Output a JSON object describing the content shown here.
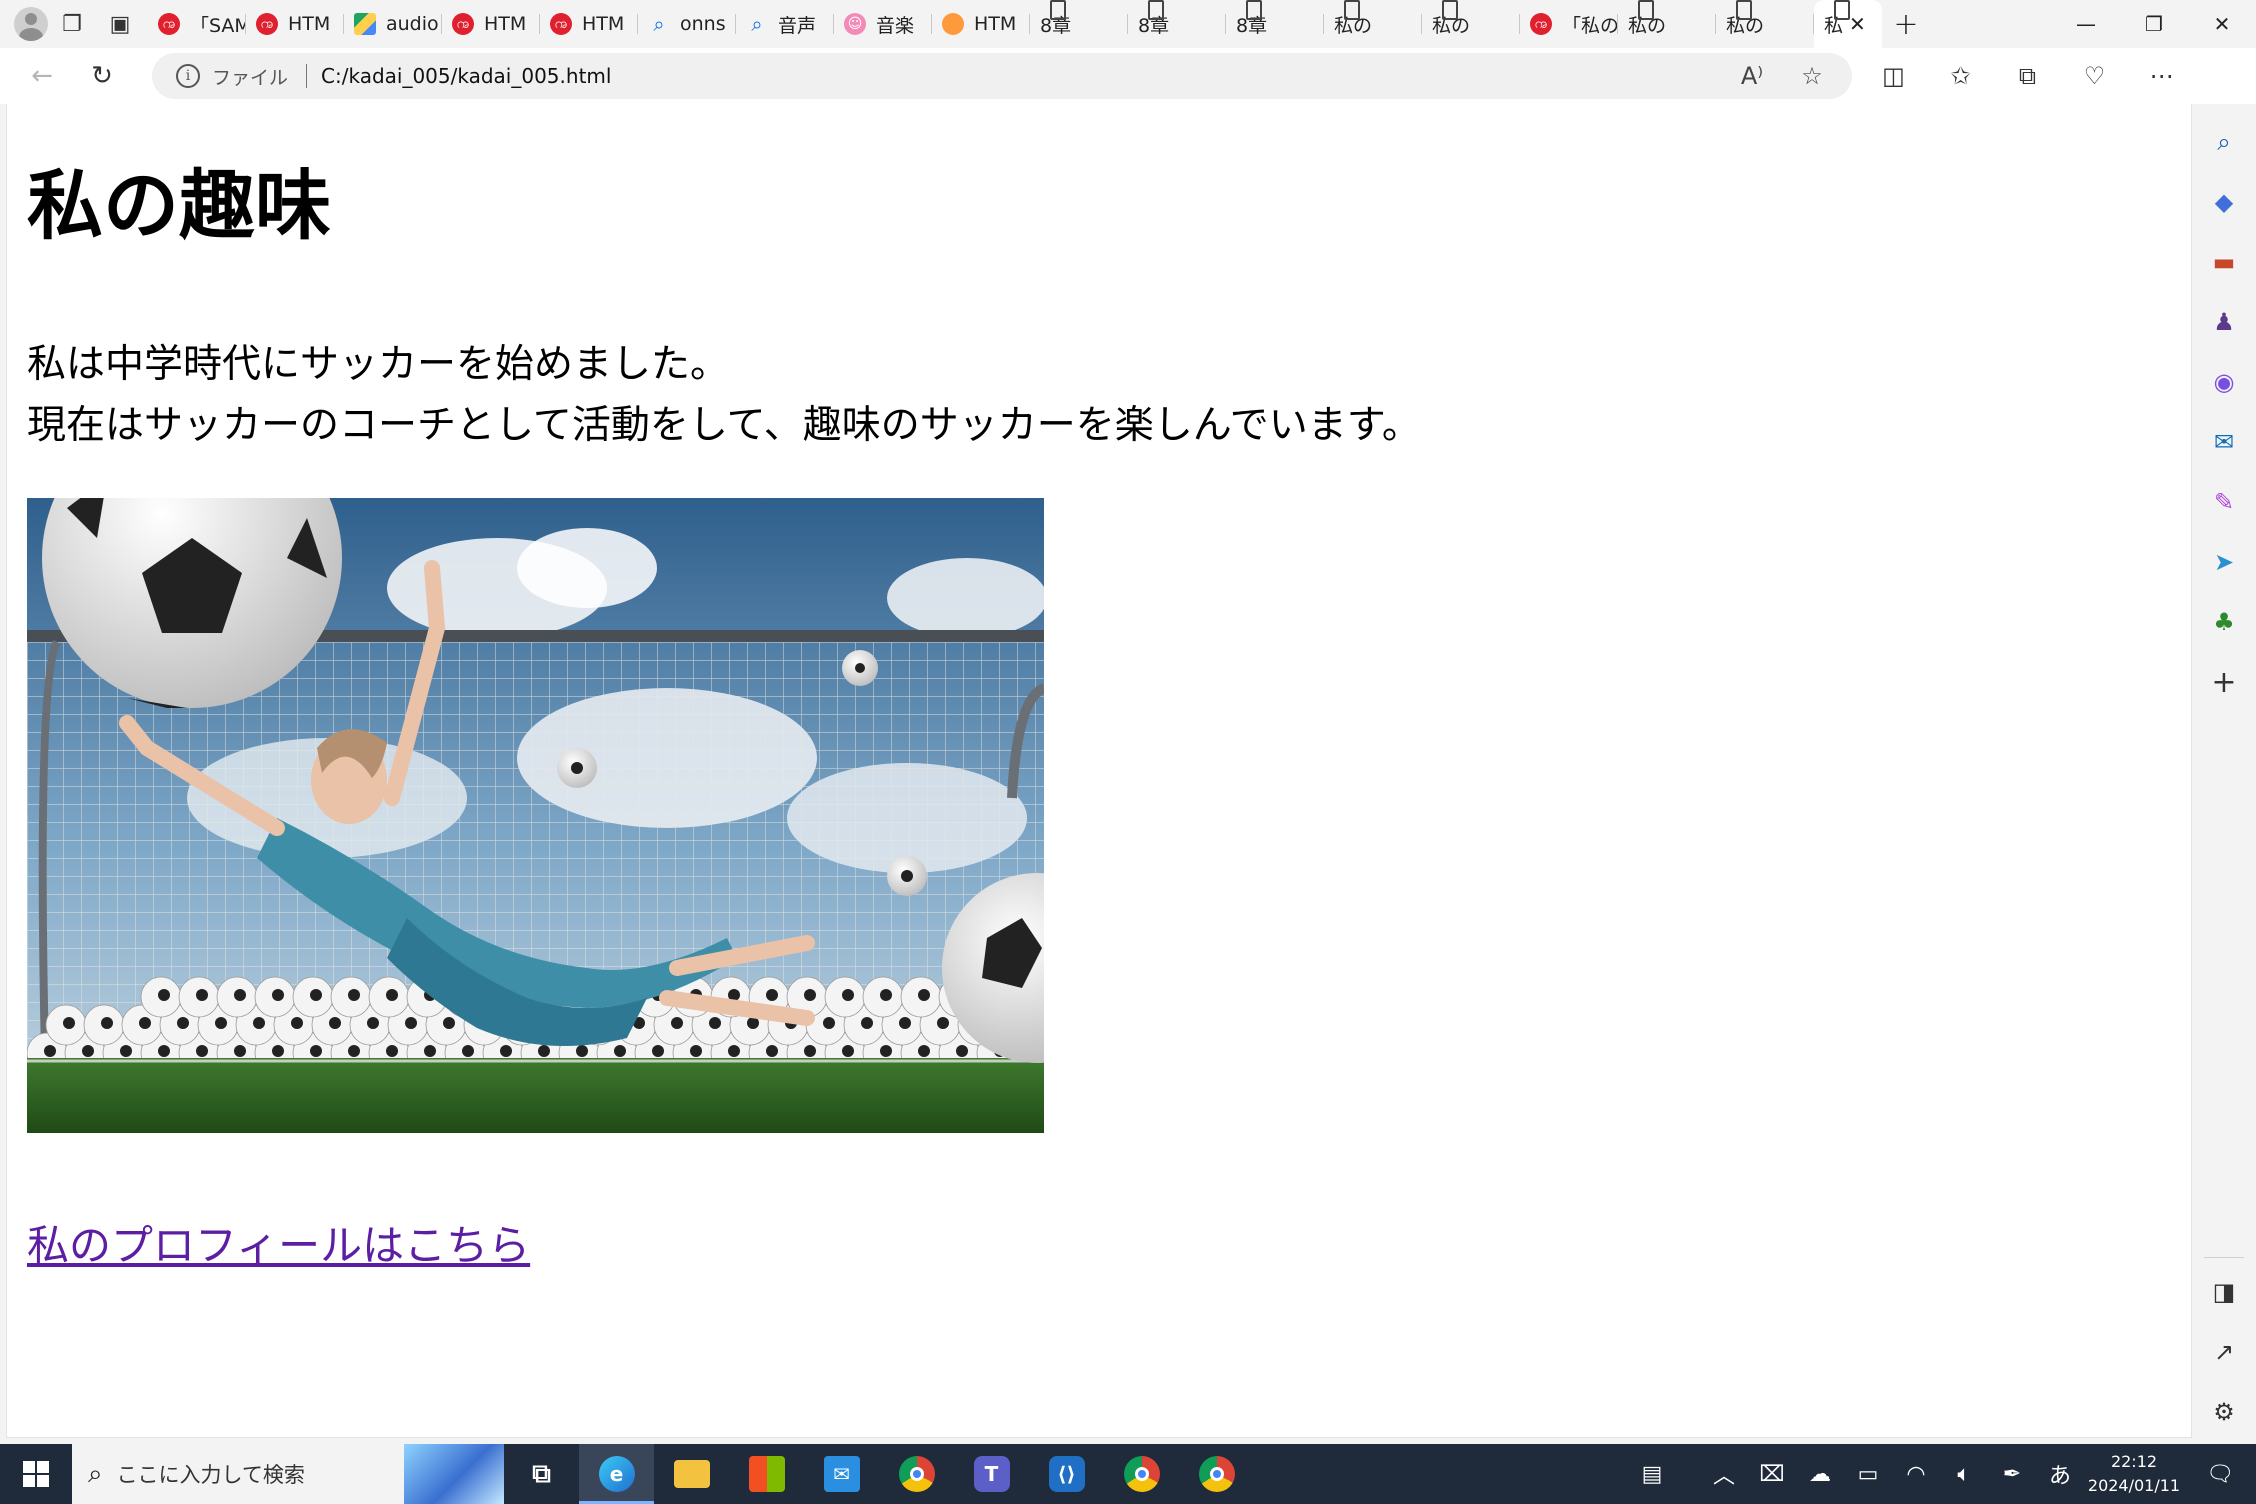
{
  "browser": {
    "tabs": [
      {
        "label": "「SAM",
        "favicon": "red-swirl-icon"
      },
      {
        "label": "HTM",
        "favicon": "red-swirl-icon"
      },
      {
        "label": "audio",
        "favicon": "google-drive-icon"
      },
      {
        "label": "HTM",
        "favicon": "red-swirl-icon"
      },
      {
        "label": "HTM",
        "favicon": "red-swirl-icon"
      },
      {
        "label": "onns",
        "favicon": "search-icon"
      },
      {
        "label": "音声",
        "favicon": "search-icon"
      },
      {
        "label": "音楽",
        "favicon": "pink-face-icon"
      },
      {
        "label": "HTM",
        "favicon": "orange-circle-icon"
      },
      {
        "label": "8章",
        "favicon": "page-icon"
      },
      {
        "label": "8章",
        "favicon": "page-icon"
      },
      {
        "label": "8章",
        "favicon": "page-icon"
      },
      {
        "label": "私の",
        "favicon": "page-icon"
      },
      {
        "label": "私の",
        "favicon": "page-icon"
      },
      {
        "label": "「私の",
        "favicon": "red-swirl-icon"
      },
      {
        "label": "私の",
        "favicon": "page-icon"
      },
      {
        "label": "私の",
        "favicon": "page-icon"
      }
    ],
    "active_tab": {
      "label": "私",
      "favicon": "page-icon"
    },
    "address": {
      "scheme_label": "ファイル",
      "url": "C:/kadai_005/kadai_005.html"
    }
  },
  "page": {
    "heading": "私の趣味",
    "paragraph_line1": "私は中学時代にサッカーを始めました。",
    "paragraph_line2": "現在はサッカーのコーチとして活動をして、趣味のサッカーを楽しんでいます。",
    "image_alt": "soccer goalkeeper girl diving in front of a goal",
    "link_text": "私のプロフィールはこちら",
    "link_color": "#5c1fa3"
  },
  "sidebar": {
    "icons": [
      "search-icon",
      "tag-icon",
      "toolbox-icon",
      "chess-icon",
      "microsoft365-icon",
      "outlook-icon",
      "designer-icon",
      "send-icon",
      "tree-icon",
      "add-icon"
    ],
    "bottom_icons": [
      "sidebar-toggle-icon",
      "external-link-icon",
      "settings-icon"
    ]
  },
  "taskbar": {
    "search_placeholder": "ここに入力して検索",
    "apps": [
      "task-view-icon",
      "edge-icon",
      "file-explorer-icon",
      "store-icon",
      "mail-icon",
      "chrome-icon",
      "teams-icon",
      "vscode-icon",
      "chrome-profile-icon",
      "chrome-icon"
    ],
    "ime": "あ",
    "time": "22:12",
    "date": "2024/01/11"
  }
}
